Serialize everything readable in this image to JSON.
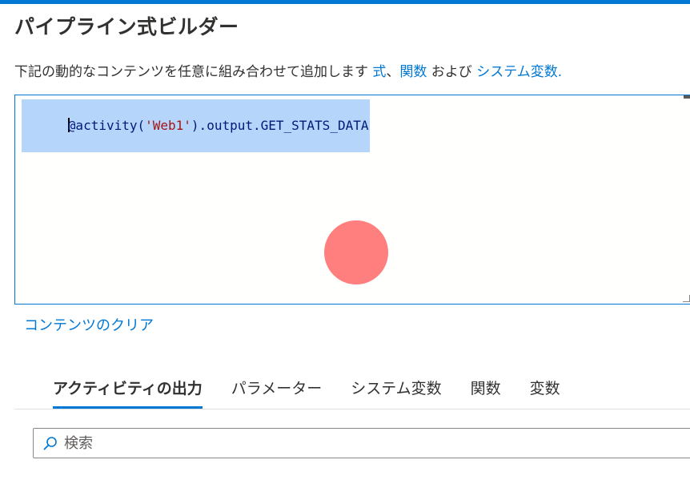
{
  "header": {
    "title": "パイプライン式ビルダー"
  },
  "description": {
    "prefix": "下記の動的なコンテンツを任意に組み合わせて追加します ",
    "link_expressions": "式",
    "separator": "、",
    "link_functions": "関数",
    "middle": " および ",
    "link_system_variables": "システム変数",
    "suffix": "."
  },
  "editor": {
    "tokens": {
      "part1": "@activity(",
      "part2": "'Web1'",
      "part3": ").output.GET_STATS_DATA"
    },
    "colors": {
      "selection": "#b5d5fb",
      "default_token": "#001a7a",
      "string_token": "#a31515"
    }
  },
  "actions": {
    "clear_content": "コンテンツのクリア"
  },
  "tabs": [
    {
      "label": "アクティビティの出力",
      "active": true
    },
    {
      "label": "パラメーター",
      "active": false
    },
    {
      "label": "システム変数",
      "active": false
    },
    {
      "label": "関数",
      "active": false
    },
    {
      "label": "変数",
      "active": false
    }
  ],
  "search": {
    "placeholder": "検索",
    "value": ""
  },
  "theme": {
    "accent": "#0078d4",
    "click_marker": "#ff7f7f"
  }
}
